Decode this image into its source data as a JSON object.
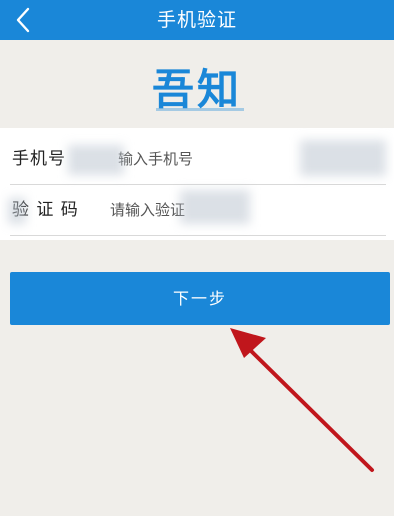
{
  "header": {
    "title": "手机验证",
    "back_icon": "chevron-left-icon"
  },
  "logo": {
    "text": "吾知"
  },
  "form": {
    "phone": {
      "label": "手机号",
      "placeholder": "输入手机号"
    },
    "code": {
      "label": "验 证 码",
      "placeholder": "请输入验证"
    }
  },
  "actions": {
    "next_label": "下一步"
  },
  "colors": {
    "accent": "#1a87d8",
    "background": "#f0eeea",
    "annotation_arrow": "#c0161c"
  }
}
